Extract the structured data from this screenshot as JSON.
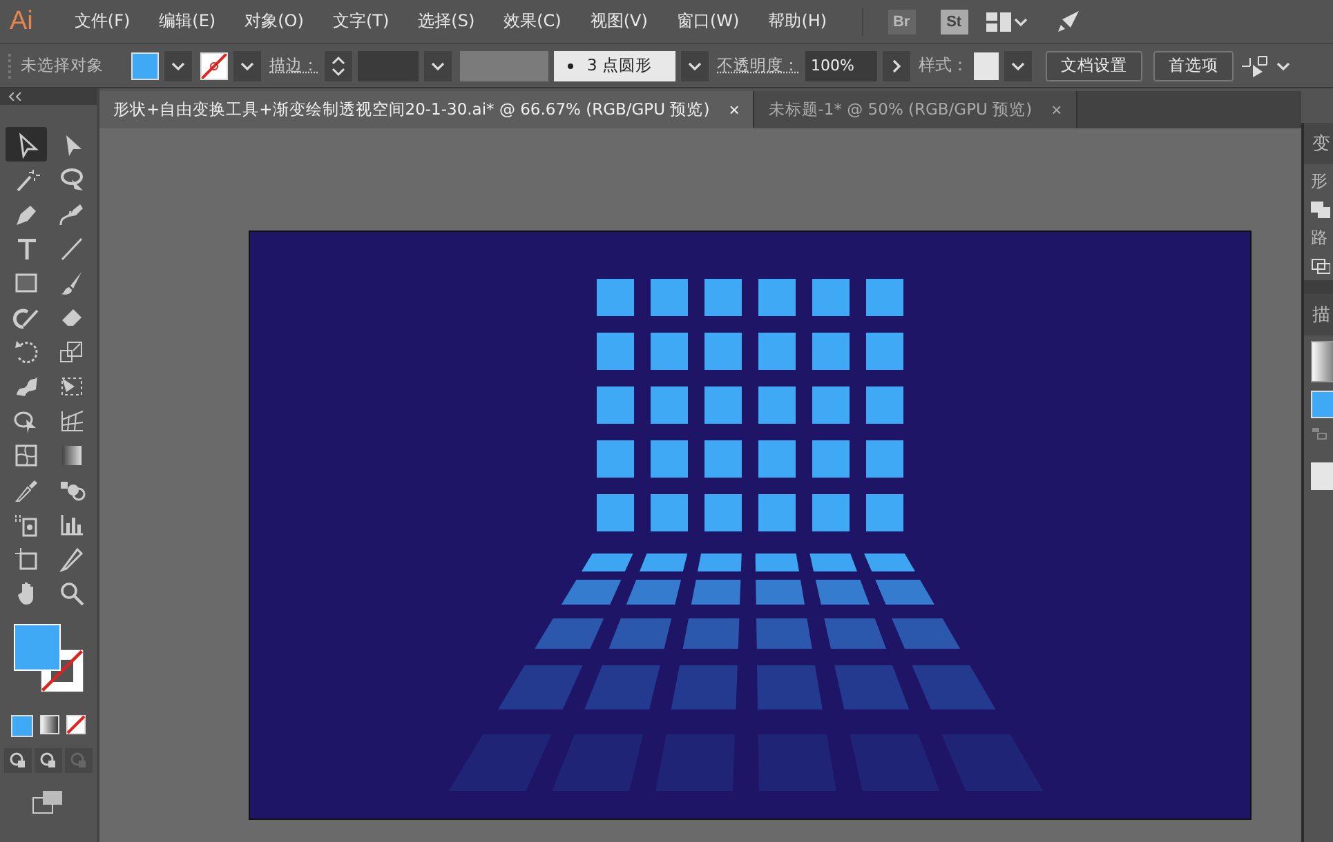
{
  "menu_bar": {
    "logo": "Ai",
    "items": [
      "文件(F)",
      "编辑(E)",
      "对象(O)",
      "文字(T)",
      "选择(S)",
      "效果(C)",
      "视图(V)",
      "窗口(W)",
      "帮助(H)"
    ],
    "badges": [
      "Br",
      "St"
    ]
  },
  "control_bar": {
    "selection": "未选择对象",
    "stroke_label": "描边：",
    "brush": "3 点圆形",
    "opacity_label": "不透明度：",
    "opacity": "100%",
    "style_label": "样式：",
    "buttons": [
      "文档设置",
      "首选项"
    ]
  },
  "tabs": [
    {
      "label": "形状+自由变换工具+渐变绘制透视空间20-1-30.ai* @ 66.67% (RGB/GPU 预览)",
      "selected": true,
      "close": "×"
    },
    {
      "label": "未标题-1* @ 50% (RGB/GPU 预览)",
      "selected": false,
      "close": "×"
    }
  ],
  "tools": [
    {
      "kind": "selection",
      "selected": true
    },
    {
      "kind": "direct",
      "selected": false
    },
    {
      "kind": "wand",
      "selected": false
    },
    {
      "kind": "lasso",
      "selected": false
    },
    {
      "kind": "pen",
      "selected": false
    },
    {
      "kind": "curvature",
      "selected": false
    },
    {
      "kind": "type",
      "selected": false
    },
    {
      "kind": "line",
      "selected": false
    },
    {
      "kind": "rect",
      "selected": false
    },
    {
      "kind": "brush",
      "selected": false
    },
    {
      "kind": "shaper",
      "selected": false
    },
    {
      "kind": "eraser",
      "selected": false
    },
    {
      "kind": "rotate",
      "selected": false
    },
    {
      "kind": "scale",
      "selected": false
    },
    {
      "kind": "warp",
      "selected": false
    },
    {
      "kind": "transform",
      "selected": false
    },
    {
      "kind": "builder",
      "selected": false
    },
    {
      "kind": "perspective",
      "selected": false
    },
    {
      "kind": "mesh",
      "selected": false
    },
    {
      "kind": "gradient",
      "selected": false
    },
    {
      "kind": "eyedropper",
      "selected": false
    },
    {
      "kind": "blend",
      "selected": false
    },
    {
      "kind": "sprayer",
      "selected": false
    },
    {
      "kind": "graph",
      "selected": false
    },
    {
      "kind": "artboard",
      "selected": false
    },
    {
      "kind": "knife",
      "selected": false
    },
    {
      "kind": "hand",
      "selected": false
    },
    {
      "kind": "zoom",
      "selected": false
    }
  ],
  "right_panel": {
    "titles": [
      "变",
      "描"
    ],
    "labels": [
      "形",
      "路"
    ]
  }
}
